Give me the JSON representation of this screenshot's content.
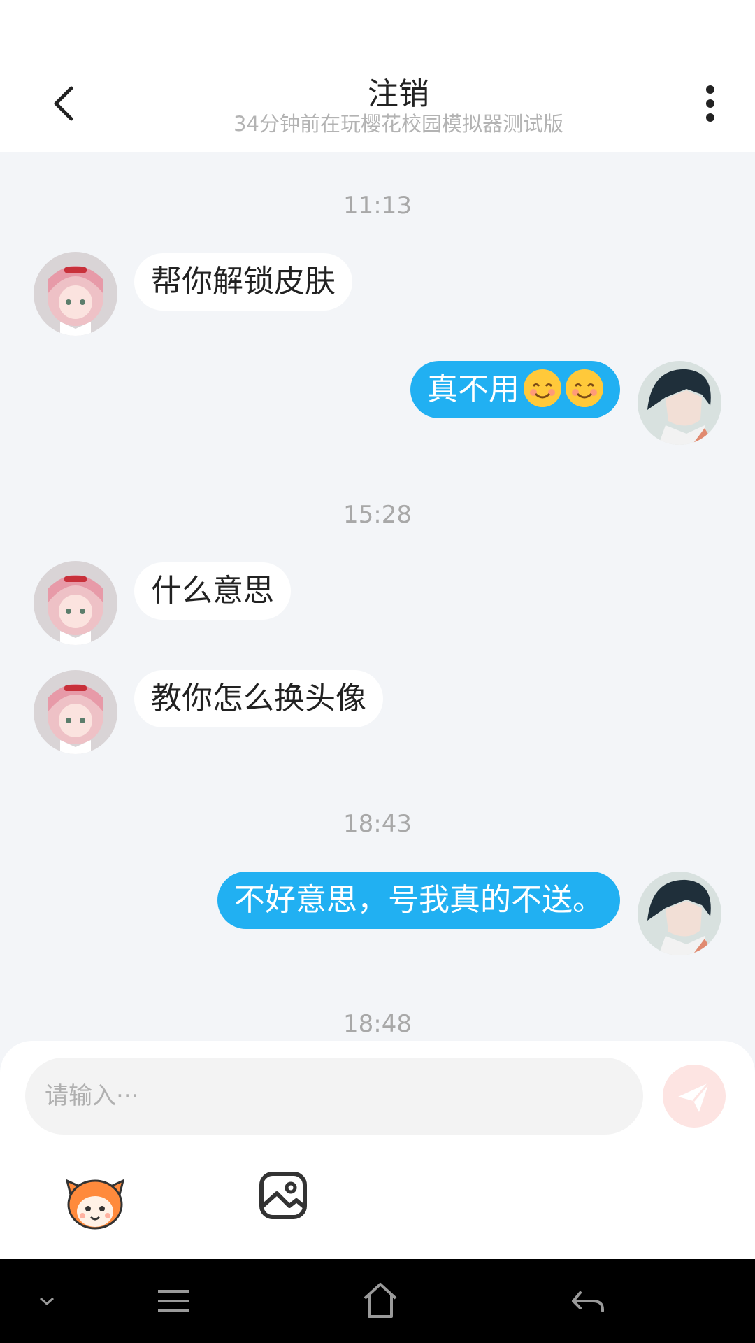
{
  "header": {
    "title": "注销",
    "subtitle": "34分钟前在玩樱花校园模拟器测试版"
  },
  "messages": [
    {
      "timestamp": "11:13"
    },
    {
      "from": "other",
      "text": "帮你解锁皮肤"
    },
    {
      "from": "me",
      "text": "真不用",
      "emoji": [
        "smiling-face",
        "smiling-face"
      ]
    },
    {
      "timestamp": "15:28"
    },
    {
      "from": "other",
      "text": "什么意思"
    },
    {
      "from": "other",
      "text": "教你怎么换头像"
    },
    {
      "timestamp": "18:43"
    },
    {
      "from": "me",
      "text": "不好意思，号我真的不送。"
    },
    {
      "timestamp": "18:48"
    }
  ],
  "composer": {
    "placeholder": "请输入···"
  },
  "icons": {
    "back": "chevron-left-icon",
    "more": "more-vertical-icon",
    "send": "paper-plane-icon",
    "mascot": "mascot-sticker-icon",
    "image": "image-picker-icon",
    "nav": [
      "chevron-down-icon",
      "menu-icon",
      "home-icon",
      "back-arrow-icon"
    ]
  },
  "colors": {
    "outgoing_bubble": "#21b0f2",
    "incoming_bubble": "#ffffff",
    "chat_background": "#f3f5f8",
    "send_button": "#fde4e2"
  }
}
